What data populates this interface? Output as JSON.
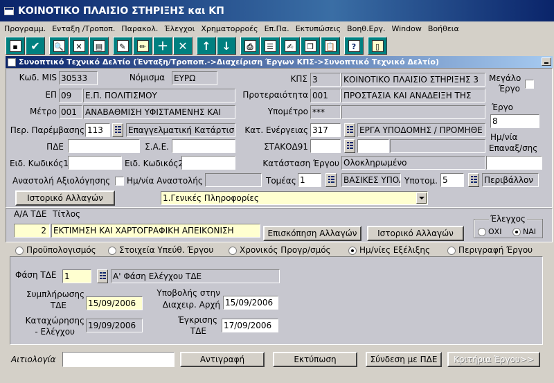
{
  "window": {
    "title": "ΚΟΙΝΟΤΙΚΟ ΠΛΑΙΣΙΟ ΣΤΗΡΙΞΗΣ και ΚΠ"
  },
  "menu": [
    "Προγραμμ.",
    "Ενταξη /Τροποπ.",
    "Παρακολ.",
    "Έλεγχοι",
    "Χρηματορροές",
    "Επ.Πα.",
    "Εκτυπώσεις",
    "Βοηθ.Εργ.",
    "Window",
    "Βοήθεια"
  ],
  "toolbar": {
    "help_glyph": "?"
  },
  "subwindow": {
    "title": "Συνοπτικό Τεχνικό Δελτίο (Ένταξη/Τροποπ.->Διαχείριση Έργων ΚΠΣ->Συνοπτικό Τεχνικό Δελτίο)"
  },
  "header": {
    "mis_label": "Κωδ. MIS",
    "mis_value": "30533",
    "currency_label": "Νόμισμα",
    "currency_value": "ΕΥΡΩ",
    "kps_label": "ΚΠΣ",
    "kps_code": "3",
    "kps_name": "ΚΟΙΝΟΤΙΚΟ ΠΛΑΙΣΙΟ ΣΤΗΡΙΞΗΣ 3",
    "big_project_label_1": "Μεγάλο",
    "big_project_label_2": "Έργο",
    "ep_label": "ΕΠ",
    "ep_code": "09",
    "ep_name": "Ε.Π. ΠΟΛΙΤΙΣΜΟΥ",
    "priority_label": "Προτεραιότητα",
    "priority_code": "001",
    "priority_name": "ΠΡΟΣΤΑΣΙΑ ΚΑΙ ΑΝΑΔΕΙΞΗ ΤΗΣ",
    "project_label": "Έργο",
    "project_value": "8",
    "measure_label": "Μέτρο",
    "measure_code": "001",
    "measure_name": "ΑΝΑΒΑΘΜΙΣΗ ΥΦΙΣΤΑΜΕΝΗΣ ΚΑΙ",
    "submeasure_label": "Υπομέτρο",
    "submeasure_code": "***",
    "submeasure_name": "",
    "intervention_label": "Περ. Παρέμβασης",
    "intervention_code": "113",
    "intervention_name": "Επαγγελματική Κατάρτιση",
    "activity_label": "Κατ. Ενέργειας",
    "activity_code": "317",
    "activity_name": "ΕΡΓΑ ΥΠΟΔΟΜΗΣ / ΠΡΟΜΗΘΕ",
    "reconfirm_label_1": "Ημ/νία",
    "reconfirm_label_2": "Επαναξ/σης",
    "pde_label": "ΠΔΕ",
    "pde_value": "",
    "sae_label": "Σ.Α.Ε.",
    "sae_value": "",
    "stakod_label": "ΣΤΑΚΟΔ91",
    "stakod_code": "",
    "stakod_name": "",
    "special1_label": "Ειδ. Κωδικός1",
    "special1_value": "",
    "special2_label": "Ειδ. Κωδικός2",
    "special2_value": "",
    "status_label": "Κατάσταση Έργου",
    "status_value": "Ολοκληρωμένο",
    "suspension_label": "Αναστολή Αξιολόγησης",
    "suspension_date_label": "Ημ/νία Αναστολής",
    "suspension_date_value": "",
    "sector_label": "Τομέας",
    "sector_code": "1",
    "sector_name": "ΒΑΣΙΚΕΣ ΥΠΟΔΟΜΕΣ",
    "subsector_label": "Υποτομ.",
    "subsector_code": "5",
    "subsector_name": "Περιβάλλον",
    "history_button": "Ιστορικό Αλλαγών",
    "section_select": "1.Γενικές Πληροφορίες"
  },
  "tde": {
    "aa_label": "Α/Α ΤΔΕ",
    "title_label": "Τίτλος",
    "aa_value": "2",
    "title_value": "ΕΚΤΙΜΗΣΗ ΚΑΙ ΧΑΡΤΟΓΡΑΦΙΚΗ ΑΠΕΙΚΟΝΙΣΗ",
    "review_button": "Επισκόπηση Αλλαγών",
    "history_button": "Ιστορικό Αλλαγών",
    "check_label": "Έλεγχος",
    "check_no": "ΟΧΙ",
    "check_yes": "ΝΑΙ"
  },
  "tabs": [
    "Προϋπολογισμός",
    "Στοιχεία Υπεύθ. Έργου",
    "Χρονικός Προγρ/σμός",
    "Ημ/νίες Εξέλιξης",
    "Περιγραφή Έργου"
  ],
  "phase": {
    "label": "Φάση ΤΔΕ",
    "code": "1",
    "name": "Α' Φάση Ελέγχου ΤΔΕ",
    "completion_label_1": "Συμπλήρωσης",
    "completion_label_2": "ΤΔΕ",
    "completion_value": "15/09/2006",
    "submission_label_1": "Υποβολής στην",
    "submission_label_2": "Διαχειρ. Αρχή",
    "submission_value": "15/09/2006",
    "registration_label_1": "Καταχώρησης",
    "registration_label_2": "- Ελέγχου",
    "registration_value": "19/09/2006",
    "approval_label_1": "Έγκρισης",
    "approval_label_2": "ΤΔΕ",
    "approval_value": "17/09/2006"
  },
  "footer": {
    "justification_label": "Αιτιολογία",
    "justification_value": "",
    "copy_button": "Αντιγραφή",
    "print_button": "Εκτύπωση",
    "link_button": "Σύνδεση με ΠΔΕ",
    "criteria_button": "Κριτήρια Έργου>>"
  }
}
